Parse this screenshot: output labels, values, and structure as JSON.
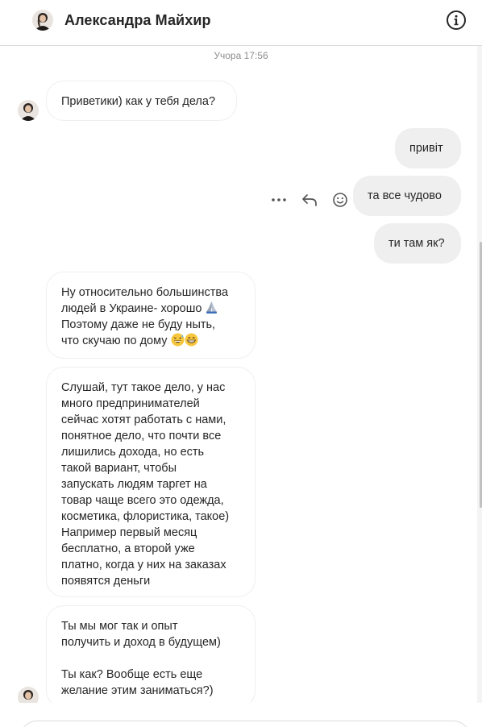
{
  "header": {
    "contact_name": "Александра Майхир"
  },
  "chat": {
    "timestamp": "Учора 17:56",
    "messages": [
      {
        "direction": "in",
        "text": "Приветики) как у тебя дела?"
      },
      {
        "direction": "out",
        "text": "привіт"
      },
      {
        "direction": "out",
        "text": "та все чудово"
      },
      {
        "direction": "out",
        "text": "ти там як?"
      },
      {
        "direction": "in",
        "line1": "Ну относительно большинства",
        "line2": "людей в Украине- хорошо",
        "line3": "Поэтому даже не буду ныть,",
        "line4": "что скучаю по дому"
      },
      {
        "direction": "in",
        "text": "Слушай, тут такое дело, у нас\nмного предпринимателей\nсейчас хотят работать с нами,\nпонятное дело, что почти все\nлишились дохода, но есть\nтакой вариант, чтобы\nзапускать людям таргет на\nтовар чаще всего это одежда,\nкосметика, флористика, такое)\nНапример первый месяц\nбесплатно, а второй уже\nплатно, когда у них на заказах\nпоявятся деньги"
      },
      {
        "direction": "in",
        "text": "Ты мы мог так и опыт\nполучить и доход в будущем)\n\nТы как? Вообще есть еще\nжелание этим заниматься?)"
      }
    ]
  },
  "icons": {
    "info": "info-circle-icon",
    "more": "more-horizontal-icon",
    "reply": "reply-arrow-icon",
    "react": "smiley-icon",
    "emoji_pray": "folded-hands-emoji",
    "emoji_sweat_smile": "grinning-sweat-emoji",
    "emoji_grin": "beaming-grin-emoji"
  },
  "colors": {
    "outgoing_bubble": "#efefef",
    "incoming_border": "#efefef",
    "divider": "#dbdbdb",
    "muted_text": "#8e8e8e"
  }
}
